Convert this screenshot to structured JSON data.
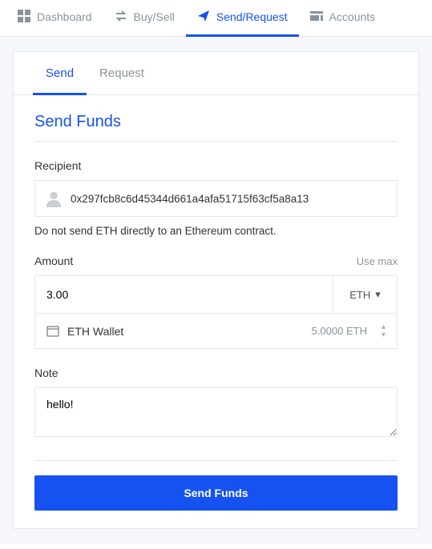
{
  "nav": {
    "dashboard": "Dashboard",
    "buysell": "Buy/Sell",
    "sendrequest": "Send/Request",
    "accounts": "Accounts"
  },
  "tabs": {
    "send": "Send",
    "request": "Request"
  },
  "form": {
    "title": "Send Funds",
    "recipient_label": "Recipient",
    "recipient_value": "0x297fcb8c6d45344d661a4afa51715f63cf5a8a13",
    "recipient_helper": "Do not send ETH directly to an Ethereum contract.",
    "amount_label": "Amount",
    "use_max": "Use max",
    "amount_value": "3.00",
    "currency": "ETH",
    "wallet_name": "ETH Wallet",
    "wallet_balance": "5.0000 ETH",
    "note_label": "Note",
    "note_value": "hello!",
    "submit": "Send Funds"
  },
  "colors": {
    "accent": "#1552f0"
  }
}
